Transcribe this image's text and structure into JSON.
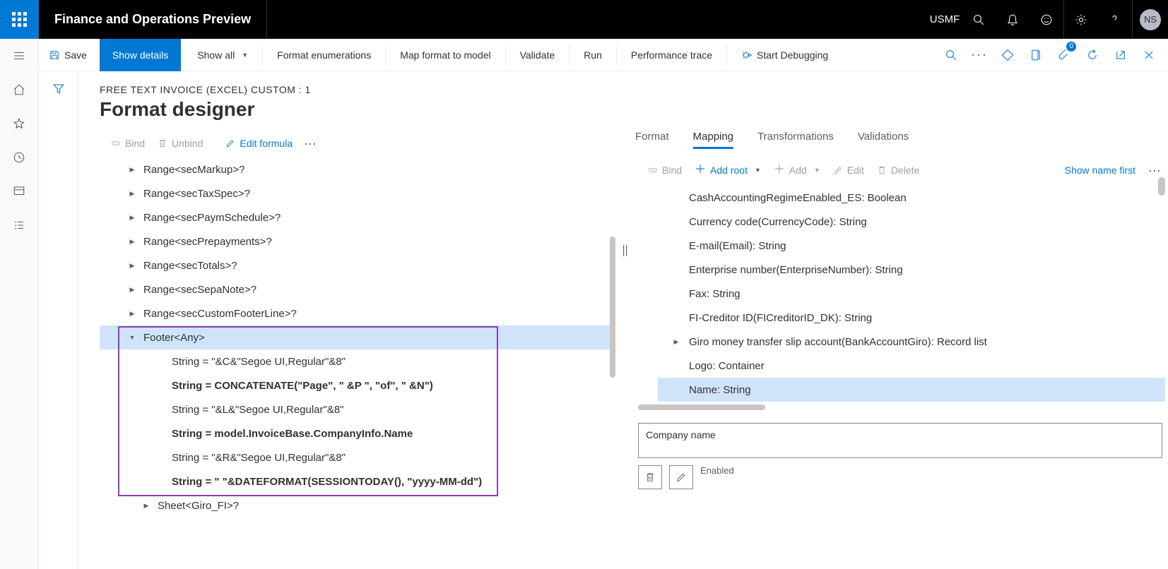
{
  "header": {
    "app_title": "Finance and Operations Preview",
    "company": "USMF",
    "avatar": "NS"
  },
  "action_bar": {
    "save": "Save",
    "show_details": "Show details",
    "show_all": "Show all",
    "format_enum": "Format enumerations",
    "map_to_model": "Map format to model",
    "validate": "Validate",
    "run": "Run",
    "perf": "Performance trace",
    "debug": "Start Debugging",
    "attach_badge": "0"
  },
  "page": {
    "breadcrumb": "FREE TEXT INVOICE (EXCEL) CUSTOM : 1",
    "title": "Format designer"
  },
  "left_tools": {
    "bind": "Bind",
    "unbind": "Unbind",
    "edit_formula": "Edit formula"
  },
  "tree": {
    "rows": [
      {
        "indent": 0,
        "caret": "closed",
        "label": "Range<secMarkup>?"
      },
      {
        "indent": 0,
        "caret": "closed",
        "label": "Range<secTaxSpec>?"
      },
      {
        "indent": 0,
        "caret": "closed",
        "label": "Range<secPaymSchedule>?"
      },
      {
        "indent": 0,
        "caret": "closed",
        "label": "Range<secPrepayments>?"
      },
      {
        "indent": 0,
        "caret": "closed",
        "label": "Range<secTotals>?"
      },
      {
        "indent": 0,
        "caret": "closed",
        "label": "Range<secSepaNote>?"
      },
      {
        "indent": 0,
        "caret": "closed",
        "label": "Range<secCustomFooterLine>?"
      },
      {
        "indent": 0,
        "caret": "open",
        "label": "Footer<Any>",
        "selected": true
      },
      {
        "indent": 1,
        "caret": "",
        "label": "String = \"&C&\"Segoe UI,Regular\"&8\""
      },
      {
        "indent": 1,
        "caret": "",
        "label": "String = CONCATENATE(\"Page\", \" &P \", \"of\", \" &N\")",
        "bold": true
      },
      {
        "indent": 1,
        "caret": "",
        "label": "String = \"&L&\"Segoe UI,Regular\"&8\""
      },
      {
        "indent": 1,
        "caret": "",
        "label": "String = model.InvoiceBase.CompanyInfo.Name",
        "bold": true
      },
      {
        "indent": 1,
        "caret": "",
        "label": "String = \"&R&\"Segoe UI,Regular\"&8\""
      },
      {
        "indent": 1,
        "caret": "",
        "label": "String = \"  \"&DATEFORMAT(SESSIONTODAY(), \"yyyy-MM-dd\")",
        "bold": true
      },
      {
        "indent": 0,
        "caret": "closed",
        "label": "Sheet<Giro_FI>?",
        "outdent": true
      }
    ]
  },
  "tabs": {
    "format": "Format",
    "mapping": "Mapping",
    "transformations": "Transformations",
    "validations": "Validations"
  },
  "map_tools": {
    "bind": "Bind",
    "add_root": "Add root",
    "add": "Add",
    "edit": "Edit",
    "delete": "Delete",
    "show_name_first": "Show name first"
  },
  "map_list": [
    {
      "label": "CashAccountingRegimeEnabled_ES: Boolean"
    },
    {
      "label": "Currency code(CurrencyCode): String"
    },
    {
      "label": "E-mail(Email): String"
    },
    {
      "label": "Enterprise number(EnterpriseNumber): String"
    },
    {
      "label": "Fax: String"
    },
    {
      "label": "FI-Creditor ID(FICreditorID_DK): String"
    },
    {
      "label": "Giro money transfer slip account(BankAccountGiro): Record list",
      "caret": true
    },
    {
      "label": "Logo: Container"
    },
    {
      "label": "Name: String",
      "selected": true
    }
  ],
  "form": {
    "description": "Company name",
    "enabled_label": "Enabled"
  }
}
